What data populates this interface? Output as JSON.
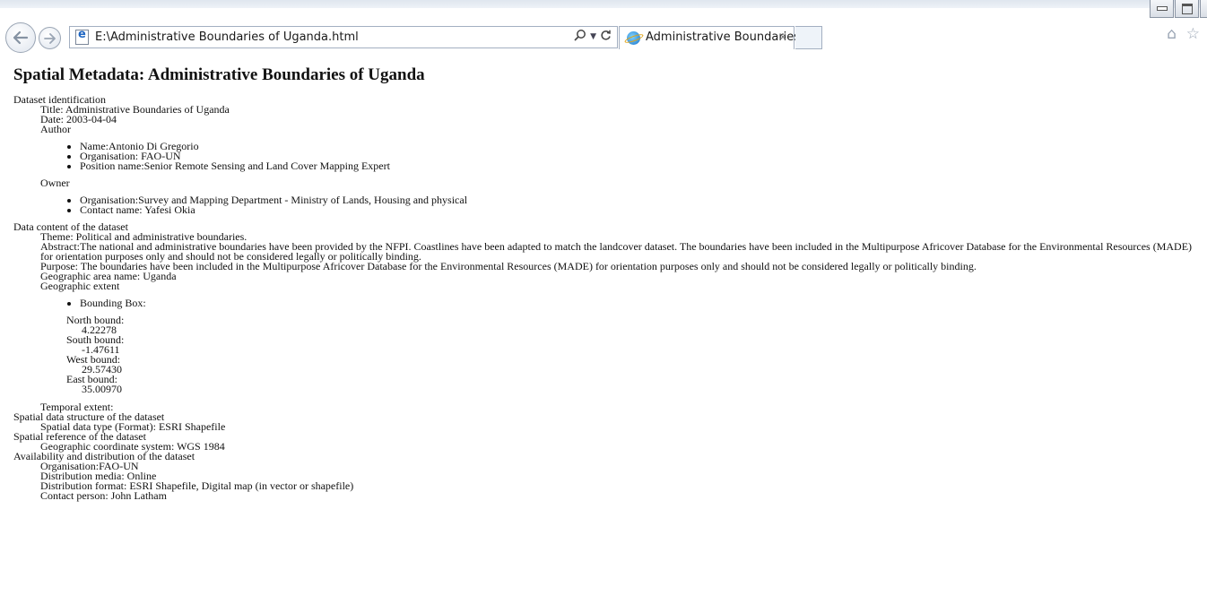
{
  "browser": {
    "url": "E:\\Administrative Boundaries of Uganda.html",
    "tab_title": "Administrative Boundaries ...",
    "tab_close": "×"
  },
  "page": {
    "heading": "Spatial Metadata: Administrative Boundaries of Uganda",
    "identification": {
      "header": "Dataset identification",
      "title": "Title: Administrative Boundaries of Uganda",
      "date": "Date: 2003-04-04",
      "author_label": "Author",
      "author_items": [
        "Name:Antonio Di Gregorio",
        "Organisation: FAO-UN",
        "Position name:Senior Remote Sensing and Land Cover Mapping Expert"
      ],
      "owner_label": "Owner",
      "owner_items": [
        "Organisation:Survey and Mapping Department - Ministry of Lands, Housing and physical",
        "Contact name: Yafesi Okia"
      ]
    },
    "content": {
      "header": "Data content of the dataset",
      "theme": "Theme: Political and administrative boundaries.",
      "abstract": "Abstract:The national and administrative boundaries have been provided by the NFPI. Coastlines have been adapted to match the landcover dataset. The boundaries have been included in the Multipurpose Africover Database for the Environmental Resources (MADE) for orientation purposes only and should not be considered legally or politically binding.",
      "purpose": "Purpose: The boundaries have been included in the Multipurpose Africover Database for the Environmental Resources (MADE) for orientation purposes only and should not be considered legally or politically binding.",
      "area": "Geographic area name: Uganda",
      "extent_label": "Geographic extent",
      "bbox_label": "Bounding Box:",
      "north_label": "North bound:",
      "north": "4.22278",
      "south_label": "South bound:",
      "south": "-1.47611",
      "west_label": "West bound:",
      "west": "29.57430",
      "east_label": "East bound:",
      "east": "35.00970",
      "temporal": "Temporal extent:"
    },
    "structure": {
      "header": "Spatial data structure of the dataset",
      "type": "Spatial data type (Format): ESRI Shapefile"
    },
    "reference": {
      "header": "Spatial reference of the dataset",
      "system": "Geographic coordinate system: WGS 1984"
    },
    "availability": {
      "header": "Availability and distribution of the dataset",
      "organisation": "Organisation:FAO-UN",
      "media": "Distribution media: Online",
      "format": "Distribution format: ESRI Shapefile, Digital map (in vector or shapefile)",
      "contact": "Contact person: John Latham"
    }
  }
}
